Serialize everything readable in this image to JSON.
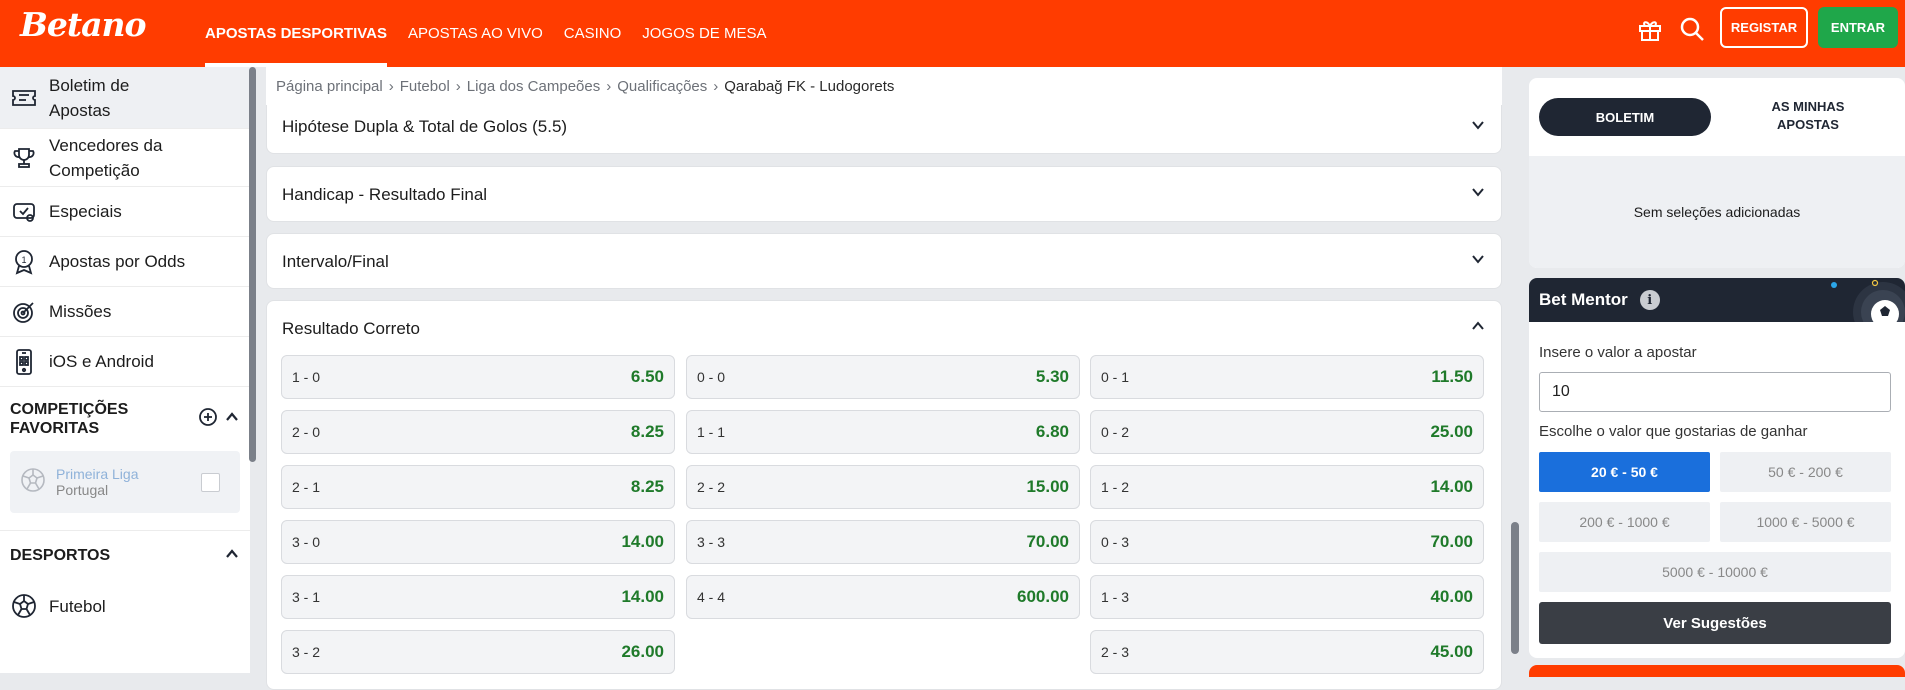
{
  "header": {
    "logo": "Betano",
    "nav": [
      {
        "label": "APOSTAS DESPORTIVAS",
        "active": true
      },
      {
        "label": "APOSTAS AO VIVO",
        "active": false
      },
      {
        "label": "CASINO",
        "active": false
      },
      {
        "label": "JOGOS DE MESA",
        "active": false
      }
    ],
    "registar": "REGISTAR",
    "entrar": "ENTRAR"
  },
  "sidebar": {
    "items": [
      {
        "label": "Boletim de Apostas",
        "icon": "ticket-icon"
      },
      {
        "label": "Vencedores da Competição",
        "icon": "trophy-icon"
      },
      {
        "label": "Especiais",
        "icon": "specials-icon"
      },
      {
        "label": "Apostas por Odds",
        "icon": "medal-icon"
      },
      {
        "label": "Missões",
        "icon": "target-icon"
      },
      {
        "label": "iOS e Android",
        "icon": "phone-icon"
      }
    ],
    "favoritas_title": "COMPETIÇÕES FAVORITAS",
    "fav": {
      "name": "Primeira Liga",
      "country": "Portugal"
    },
    "desportos_title": "DESPORTOS",
    "futebol": "Futebol"
  },
  "breadcrumb": [
    "Página principal",
    "Futebol",
    "Liga dos Campeões",
    "Qualificações"
  ],
  "breadcrumb_current": "Qarabağ FK - Ludogorets",
  "markets": {
    "m1": "Hipótese Dupla & Total de Golos (5.5)",
    "m2": "Handicap - Resultado Final",
    "m3": "Intervalo/Final",
    "m4": "Resultado Correto"
  },
  "correct_score": {
    "col1": [
      {
        "score": "1 - 0",
        "odd": "6.50"
      },
      {
        "score": "2 - 0",
        "odd": "8.25"
      },
      {
        "score": "2 - 1",
        "odd": "8.25"
      },
      {
        "score": "3 - 0",
        "odd": "14.00"
      },
      {
        "score": "3 - 1",
        "odd": "14.00"
      },
      {
        "score": "3 - 2",
        "odd": "26.00"
      }
    ],
    "col2": [
      {
        "score": "0 - 0",
        "odd": "5.30"
      },
      {
        "score": "1 - 1",
        "odd": "6.80"
      },
      {
        "score": "2 - 2",
        "odd": "15.00"
      },
      {
        "score": "3 - 3",
        "odd": "70.00"
      },
      {
        "score": "4 - 4",
        "odd": "600.00"
      }
    ],
    "col3": [
      {
        "score": "0 - 1",
        "odd": "11.50"
      },
      {
        "score": "0 - 2",
        "odd": "25.00"
      },
      {
        "score": "1 - 2",
        "odd": "14.00"
      },
      {
        "score": "0 - 3",
        "odd": "70.00"
      },
      {
        "score": "1 - 3",
        "odd": "40.00"
      },
      {
        "score": "2 - 3",
        "odd": "45.00"
      }
    ]
  },
  "betslip": {
    "tab1": "BOLETIM",
    "tab2": "AS MINHAS APOSTAS",
    "empty": "Sem seleções adicionadas"
  },
  "mentor": {
    "title": "Bet Mentor",
    "stake_label": "Insere o valor a apostar",
    "stake_value": "10",
    "win_label": "Escolhe o valor que gostarias de ganhar",
    "ranges": [
      "20 € - 50 €",
      "50 € - 200 €",
      "200 € - 1000 €",
      "1000 € - 5000 €",
      "5000 € - 10000 €"
    ],
    "button": "Ver Sugestões"
  },
  "colors": {
    "brand": "#ff3c00",
    "odds": "#1f7a2a",
    "selected": "#1a6fdc",
    "entrar": "#1fa74a"
  }
}
